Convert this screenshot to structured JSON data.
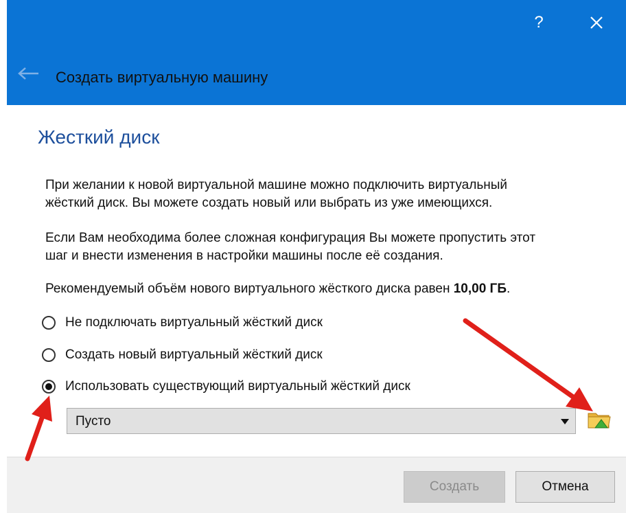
{
  "window": {
    "help_label": "?",
    "title": "Создать виртуальную машину"
  },
  "page": {
    "heading": "Жесткий диск",
    "paragraph1_line1": "При желании к новой виртуальной машине можно подключить виртуальный",
    "paragraph1_line2": "жёсткий диск. Вы можете создать новый или выбрать из уже имеющихся.",
    "paragraph2_line1": "Если Вам необходима более сложная конфигурация Вы можете пропустить этот",
    "paragraph2_line2": "шаг и внести изменения в настройки машины после её создания.",
    "recommended_text": "Рекомендуемый объём нового виртуального жёсткого диска равен ",
    "recommended_size": "10,00 ГБ",
    "recommended_suffix": "."
  },
  "options": [
    {
      "label": "Не подключать виртуальный жёсткий диск",
      "selected": false
    },
    {
      "label": "Создать новый виртуальный жёсткий диск",
      "selected": false
    },
    {
      "label": "Использовать существующий виртуальный жёсткий диск",
      "selected": true
    }
  ],
  "disk_select": {
    "value": "Пусто"
  },
  "footer": {
    "create_label": "Создать",
    "cancel_label": "Отмена"
  },
  "colors": {
    "titlebar": "#0b74d5",
    "heading": "#1d4f9c",
    "annotation_arrows": "#e0201a"
  },
  "icons": [
    "help-icon",
    "close-icon",
    "back-arrow-icon",
    "dropdown-arrow-icon",
    "folder-icon"
  ]
}
